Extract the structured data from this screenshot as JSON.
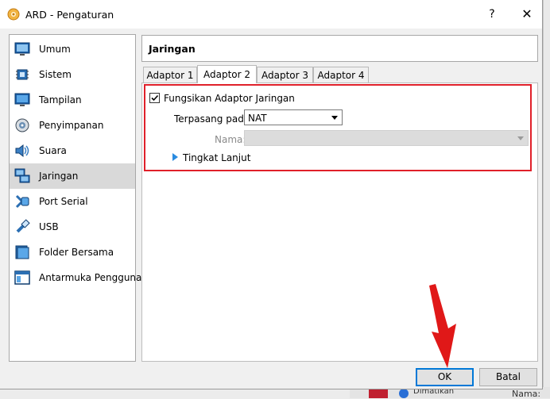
{
  "window": {
    "title": "ARD - Pengaturan",
    "help": "?",
    "close": "✕"
  },
  "sidebar": {
    "items": [
      {
        "label": "Umum",
        "icon": "monitor-icon"
      },
      {
        "label": "Sistem",
        "icon": "chip-icon"
      },
      {
        "label": "Tampilan",
        "icon": "display-icon"
      },
      {
        "label": "Penyimpanan",
        "icon": "disk-icon"
      },
      {
        "label": "Suara",
        "icon": "speaker-icon"
      },
      {
        "label": "Jaringan",
        "icon": "network-icon",
        "selected": true
      },
      {
        "label": "Port Serial",
        "icon": "serial-port-icon"
      },
      {
        "label": "USB",
        "icon": "usb-icon"
      },
      {
        "label": "Folder Bersama",
        "icon": "folder-icon"
      },
      {
        "label": "Antarmuka Pengguna",
        "icon": "window-icon"
      }
    ]
  },
  "header": {
    "title": "Jaringan"
  },
  "tabs": [
    {
      "label": "Adaptor 1"
    },
    {
      "label": "Adaptor 2",
      "active": true
    },
    {
      "label": "Adaptor 3"
    },
    {
      "label": "Adaptor 4"
    }
  ],
  "adapter": {
    "enable_label": "Fungsikan Adaptor Jaringan",
    "enabled": true,
    "attached_label": "Terpasang pada:",
    "attached_value": "NAT",
    "name_label": "Nama:",
    "name_value": "",
    "advanced_label": "Tingkat Lanjut"
  },
  "buttons": {
    "ok": "OK",
    "cancel": "Batal"
  },
  "background": {
    "status_text": "Dimatikan",
    "label_right": "Nama:"
  },
  "colors": {
    "highlight": "#e0202a",
    "focus": "#0078d7",
    "selected_row": "#d9d9d9"
  }
}
